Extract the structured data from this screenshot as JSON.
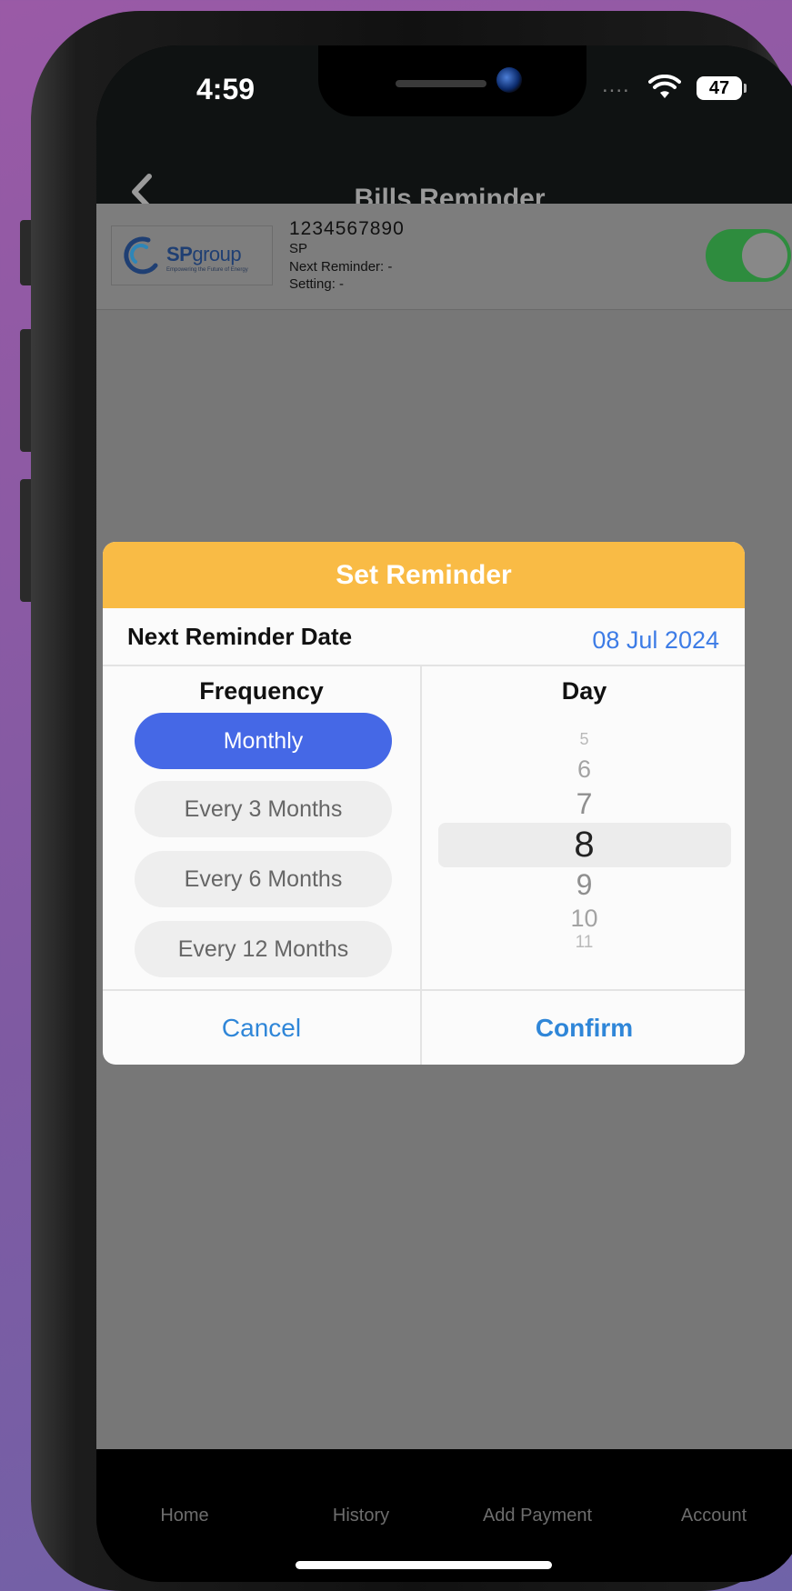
{
  "status_bar": {
    "time": "4:59",
    "signal": "....",
    "battery": "47"
  },
  "nav": {
    "title": "Bills Reminder"
  },
  "bill": {
    "logo_brand_bold": "SP",
    "logo_brand_rest": "group",
    "logo_tagline": "Empowering the Future of Energy",
    "account_number": "1234567890",
    "biller": "SP",
    "next_reminder": "Next Reminder: -",
    "setting": "Setting: -",
    "reminder_enabled": true
  },
  "modal": {
    "title": "Set Reminder",
    "date_label": "Next Reminder Date",
    "date_value": "08 Jul 2024",
    "frequency_title": "Frequency",
    "frequency_options": [
      "Monthly",
      "Every 3 Months",
      "Every 6 Months",
      "Every 12 Months"
    ],
    "frequency_selected": "Monthly",
    "day_title": "Day",
    "day_options": [
      "5",
      "6",
      "7",
      "8",
      "9",
      "10",
      "11"
    ],
    "day_selected": "8",
    "cancel_label": "Cancel",
    "confirm_label": "Confirm"
  },
  "tabbar": {
    "items": [
      "Home",
      "History",
      "Add Payment",
      "Account"
    ]
  },
  "colors": {
    "header_yellow": "#f9bb45",
    "active_blue": "#4568e6",
    "link_blue": "#2f86d8",
    "date_blue": "#3d7ce6",
    "toggle_green": "#2e8c3e"
  }
}
